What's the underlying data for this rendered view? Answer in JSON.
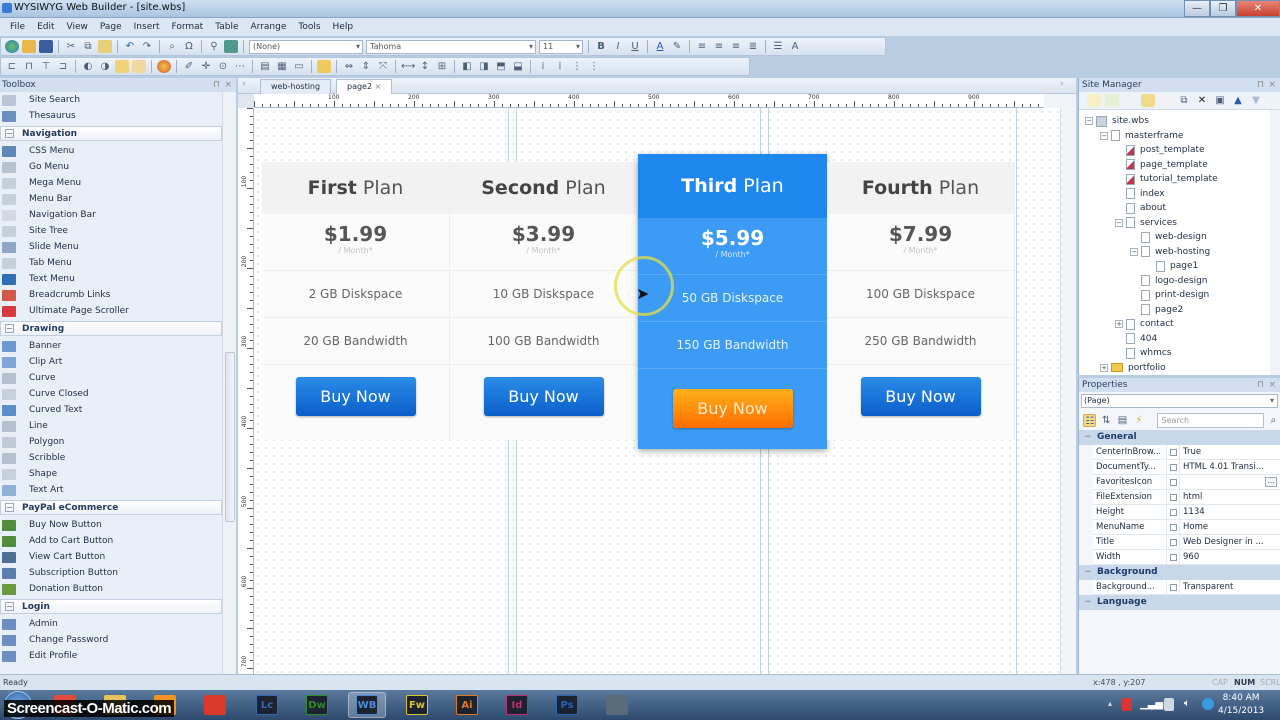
{
  "window": {
    "title": "WYSIWYG Web Builder - [site.wbs]"
  },
  "menu": [
    "File",
    "Edit",
    "View",
    "Page",
    "Insert",
    "Format",
    "Table",
    "Arrange",
    "Tools",
    "Help"
  ],
  "toolbar": {
    "style_combo": "(None)",
    "font_combo": "Tahoma",
    "size_combo": "11"
  },
  "toolbox": {
    "title": "Toolbox",
    "items": [
      {
        "type": "item",
        "label": "Site Search",
        "color": "#b8c6d8"
      },
      {
        "type": "item",
        "label": "Thesaurus",
        "color": "#6b8fbf"
      },
      {
        "type": "group",
        "label": "Navigation"
      },
      {
        "type": "item",
        "label": "CSS Menu",
        "color": "#5f86b8"
      },
      {
        "type": "item",
        "label": "Go Menu",
        "color": "#b7c2cf"
      },
      {
        "type": "item",
        "label": "Mega Menu",
        "color": "#c6d0db"
      },
      {
        "type": "item",
        "label": "Menu Bar",
        "color": "#c6d0db"
      },
      {
        "type": "item",
        "label": "Navigation Bar",
        "color": "#d3d9e1"
      },
      {
        "type": "item",
        "label": "Site Tree",
        "color": "#c6d0db"
      },
      {
        "type": "item",
        "label": "Slide Menu",
        "color": "#8ea6c4"
      },
      {
        "type": "item",
        "label": "Tab Menu",
        "color": "#c6d0db"
      },
      {
        "type": "item",
        "label": "Text Menu",
        "color": "#2f6fb6"
      },
      {
        "type": "item",
        "label": "Breadcrumb Links",
        "color": "#d3584a"
      },
      {
        "type": "item",
        "label": "Ultimate Page Scroller",
        "color": "#d63a3a"
      },
      {
        "type": "group",
        "label": "Drawing"
      },
      {
        "type": "item",
        "label": "Banner",
        "color": "#6a9ad0"
      },
      {
        "type": "item",
        "label": "Clip Art",
        "color": "#7ea6d8"
      },
      {
        "type": "item",
        "label": "Curve",
        "color": "#b4c0ce"
      },
      {
        "type": "item",
        "label": "Curve Closed",
        "color": "#c6d0db"
      },
      {
        "type": "item",
        "label": "Curved Text",
        "color": "#5c8ccb"
      },
      {
        "type": "item",
        "label": "Line",
        "color": "#b4c0ce"
      },
      {
        "type": "item",
        "label": "Polygon",
        "color": "#c0cad6"
      },
      {
        "type": "item",
        "label": "Scribble",
        "color": "#b4c0ce"
      },
      {
        "type": "item",
        "label": "Shape",
        "color": "#c6d0db"
      },
      {
        "type": "item",
        "label": "Text Art",
        "color": "#8fb0d8"
      },
      {
        "type": "group",
        "label": "PayPal eCommerce"
      },
      {
        "type": "item",
        "label": "Buy Now Button",
        "color": "#4f8c3c"
      },
      {
        "type": "item",
        "label": "Add to Cart Button",
        "color": "#4f8c3c"
      },
      {
        "type": "item",
        "label": "View Cart Button",
        "color": "#4d6f96"
      },
      {
        "type": "item",
        "label": "Subscription Button",
        "color": "#5a7fae"
      },
      {
        "type": "item",
        "label": "Donation Button",
        "color": "#6a9a3e"
      },
      {
        "type": "group",
        "label": "Login"
      },
      {
        "type": "item",
        "label": "Admin",
        "color": "#6a8fc0"
      },
      {
        "type": "item",
        "label": "Change Password",
        "color": "#6a8fc0"
      },
      {
        "type": "item",
        "label": "Edit Profile",
        "color": "#6a8fc0"
      }
    ]
  },
  "editor": {
    "tabs": [
      {
        "label": "web-hosting",
        "active": false
      },
      {
        "label": "page2",
        "active": true
      }
    ],
    "close_glyph": "×",
    "hruler_labels": [
      "100",
      "200",
      "300",
      "400",
      "500",
      "600",
      "700",
      "800",
      "900"
    ],
    "vruler_labels": [
      "100",
      "200",
      "300",
      "400",
      "500",
      "600",
      "700"
    ]
  },
  "pricing": {
    "plans": [
      {
        "name_bold": "First",
        "name_rest": " Plan",
        "price": "$1.99",
        "period": "/ Month*",
        "disk": "2 GB Diskspace",
        "bandwidth": "20 GB Bandwidth",
        "button": "Buy Now",
        "featured": false
      },
      {
        "name_bold": "Second",
        "name_rest": " Plan",
        "price": "$3.99",
        "period": "/ Month*",
        "disk": "10 GB Diskspace",
        "bandwidth": "100 GB Bandwidth",
        "button": "Buy Now",
        "featured": false
      },
      {
        "name_bold": "Third",
        "name_rest": " Plan",
        "price": "$5.99",
        "period": "/ Month*",
        "disk": "50 GB Diskspace",
        "bandwidth": "150 GB Bandwidth",
        "button": "Buy Now",
        "featured": true
      },
      {
        "name_bold": "Fourth",
        "name_rest": " Plan",
        "price": "$7.99",
        "period": "/ Month*",
        "disk": "100 GB Diskspace",
        "bandwidth": "250 GB Bandwidth",
        "button": "Buy Now",
        "featured": false
      }
    ]
  },
  "site_manager": {
    "title": "Site Manager",
    "tree": [
      {
        "label": "site.wbs",
        "depth": 0,
        "icon": "site",
        "toggle": "−"
      },
      {
        "label": "masterframe",
        "depth": 1,
        "icon": "page",
        "toggle": "−"
      },
      {
        "label": "post_template",
        "depth": 2,
        "icon": "red"
      },
      {
        "label": "page_template",
        "depth": 2,
        "icon": "red"
      },
      {
        "label": "tutorial_template",
        "depth": 2,
        "icon": "red"
      },
      {
        "label": "index",
        "depth": 2,
        "icon": "page"
      },
      {
        "label": "about",
        "depth": 2,
        "icon": "page"
      },
      {
        "label": "services",
        "depth": 2,
        "icon": "page",
        "toggle": "−"
      },
      {
        "label": "web-design",
        "depth": 3,
        "icon": "page"
      },
      {
        "label": "web-hosting",
        "depth": 3,
        "icon": "page",
        "toggle": "−"
      },
      {
        "label": "page1",
        "depth": 4,
        "icon": "page"
      },
      {
        "label": "logo-design",
        "depth": 3,
        "icon": "page"
      },
      {
        "label": "print-design",
        "depth": 3,
        "icon": "page"
      },
      {
        "label": "page2",
        "depth": 3,
        "icon": "page"
      },
      {
        "label": "contact",
        "depth": 2,
        "icon": "page",
        "toggle": "+"
      },
      {
        "label": "404",
        "depth": 2,
        "icon": "page"
      },
      {
        "label": "whmcs",
        "depth": 2,
        "icon": "page"
      },
      {
        "label": "portfolio",
        "depth": 1,
        "icon": "folder",
        "toggle": "+"
      }
    ]
  },
  "properties": {
    "title": "Properties",
    "object": "(Page)",
    "search_placeholder": "Search",
    "sections": [
      {
        "name": "General",
        "rows": [
          {
            "key": "CenterInBrow...",
            "value": "True"
          },
          {
            "key": "DocumentTy...",
            "value": "HTML 4.01 Transi..."
          },
          {
            "key": "FavoritesIcon",
            "value": "",
            "button": "..."
          },
          {
            "key": "FileExtension",
            "value": "html"
          },
          {
            "key": "Height",
            "value": "1134"
          },
          {
            "key": "MenuName",
            "value": "Home"
          },
          {
            "key": "Title",
            "value": "Web Designer in ..."
          },
          {
            "key": "Width",
            "value": "960"
          }
        ]
      },
      {
        "name": "Background",
        "rows": [
          {
            "key": "Background...",
            "value": "Transparent"
          }
        ]
      },
      {
        "name": "Language",
        "rows": []
      }
    ]
  },
  "status": {
    "ready": "Ready",
    "coords": "x:478 , y:207",
    "caps": "CAP",
    "num": "NUM",
    "scrl": "SCRL"
  },
  "taskbar": {
    "apps": [
      {
        "name": "chrome",
        "label": "",
        "color": "#e34b3b"
      },
      {
        "name": "file-explorer",
        "label": "",
        "color": "#e7c35a"
      },
      {
        "name": "vlc",
        "label": "",
        "color": "#f29422"
      },
      {
        "name": "acrobat",
        "label": "",
        "color": "#d93a2c"
      },
      {
        "name": "livecycle",
        "label": "Lc",
        "color": "#3a68b0"
      },
      {
        "name": "dreamweaver",
        "label": "Dw",
        "color": "#2f8a2a"
      },
      {
        "name": "web-builder",
        "label": "WB",
        "color": "#4d8bd9"
      },
      {
        "name": "fireworks",
        "label": "Fw",
        "color": "#d8c32a"
      },
      {
        "name": "illustrator",
        "label": "Ai",
        "color": "#d97b18"
      },
      {
        "name": "indesign",
        "label": "Id",
        "color": "#c22d6b"
      },
      {
        "name": "photoshop",
        "label": "Ps",
        "color": "#2a64b3"
      },
      {
        "name": "snipping",
        "label": "",
        "color": "#5c6b7a"
      }
    ],
    "clock_time": "8:40 AM",
    "clock_date": "4/15/2013",
    "watermark": "Screencast-O-Matic.com"
  }
}
